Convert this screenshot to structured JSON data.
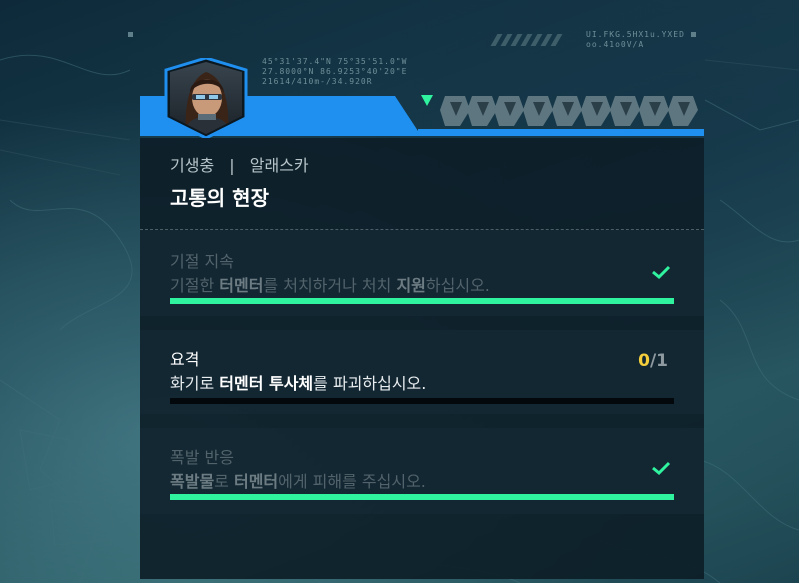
{
  "hud": {
    "coords_left": [
      "45°31'37.4\"N 75°35'51.0\"W",
      "27.8000°N 86.9253°40'20\"E",
      "21614/410m-/34.920R"
    ],
    "coords_right": [
      "UI.FKG.5HX1u.YXED",
      "oo.41o0V/A"
    ]
  },
  "quest": {
    "category": "기생충",
    "location": "알래스카",
    "separator": "|",
    "title": "고통의 현장"
  },
  "objectives": [
    {
      "name": "기절 지속",
      "desc": [
        "기절한 ",
        "터멘터",
        "를 처치하거나 처치 ",
        "지원",
        "하십시오."
      ],
      "status": "complete",
      "progress_fraction": 1.0
    },
    {
      "name": "요격",
      "desc": [
        "화기로 ",
        "터멘터 투사체",
        "를 파괴하십시오."
      ],
      "status": "active",
      "progress_current": "0",
      "progress_separator": "/",
      "progress_total": "1",
      "progress_fraction": 0.0
    },
    {
      "name": "폭발 반응",
      "desc": [
        "폭발물",
        "로 ",
        "터멘터",
        "에게 피해를 주십시오."
      ],
      "status": "complete",
      "progress_fraction": 1.0
    }
  ],
  "colors": {
    "accent_blue": "#1f8ff0",
    "progress_green": "#2ff39e",
    "marker_green": "#2ff39e",
    "counter_yellow": "#f5cf3b"
  },
  "icons": [
    "portrait-avatar",
    "location-marker-icon",
    "checkmark-icon"
  ]
}
